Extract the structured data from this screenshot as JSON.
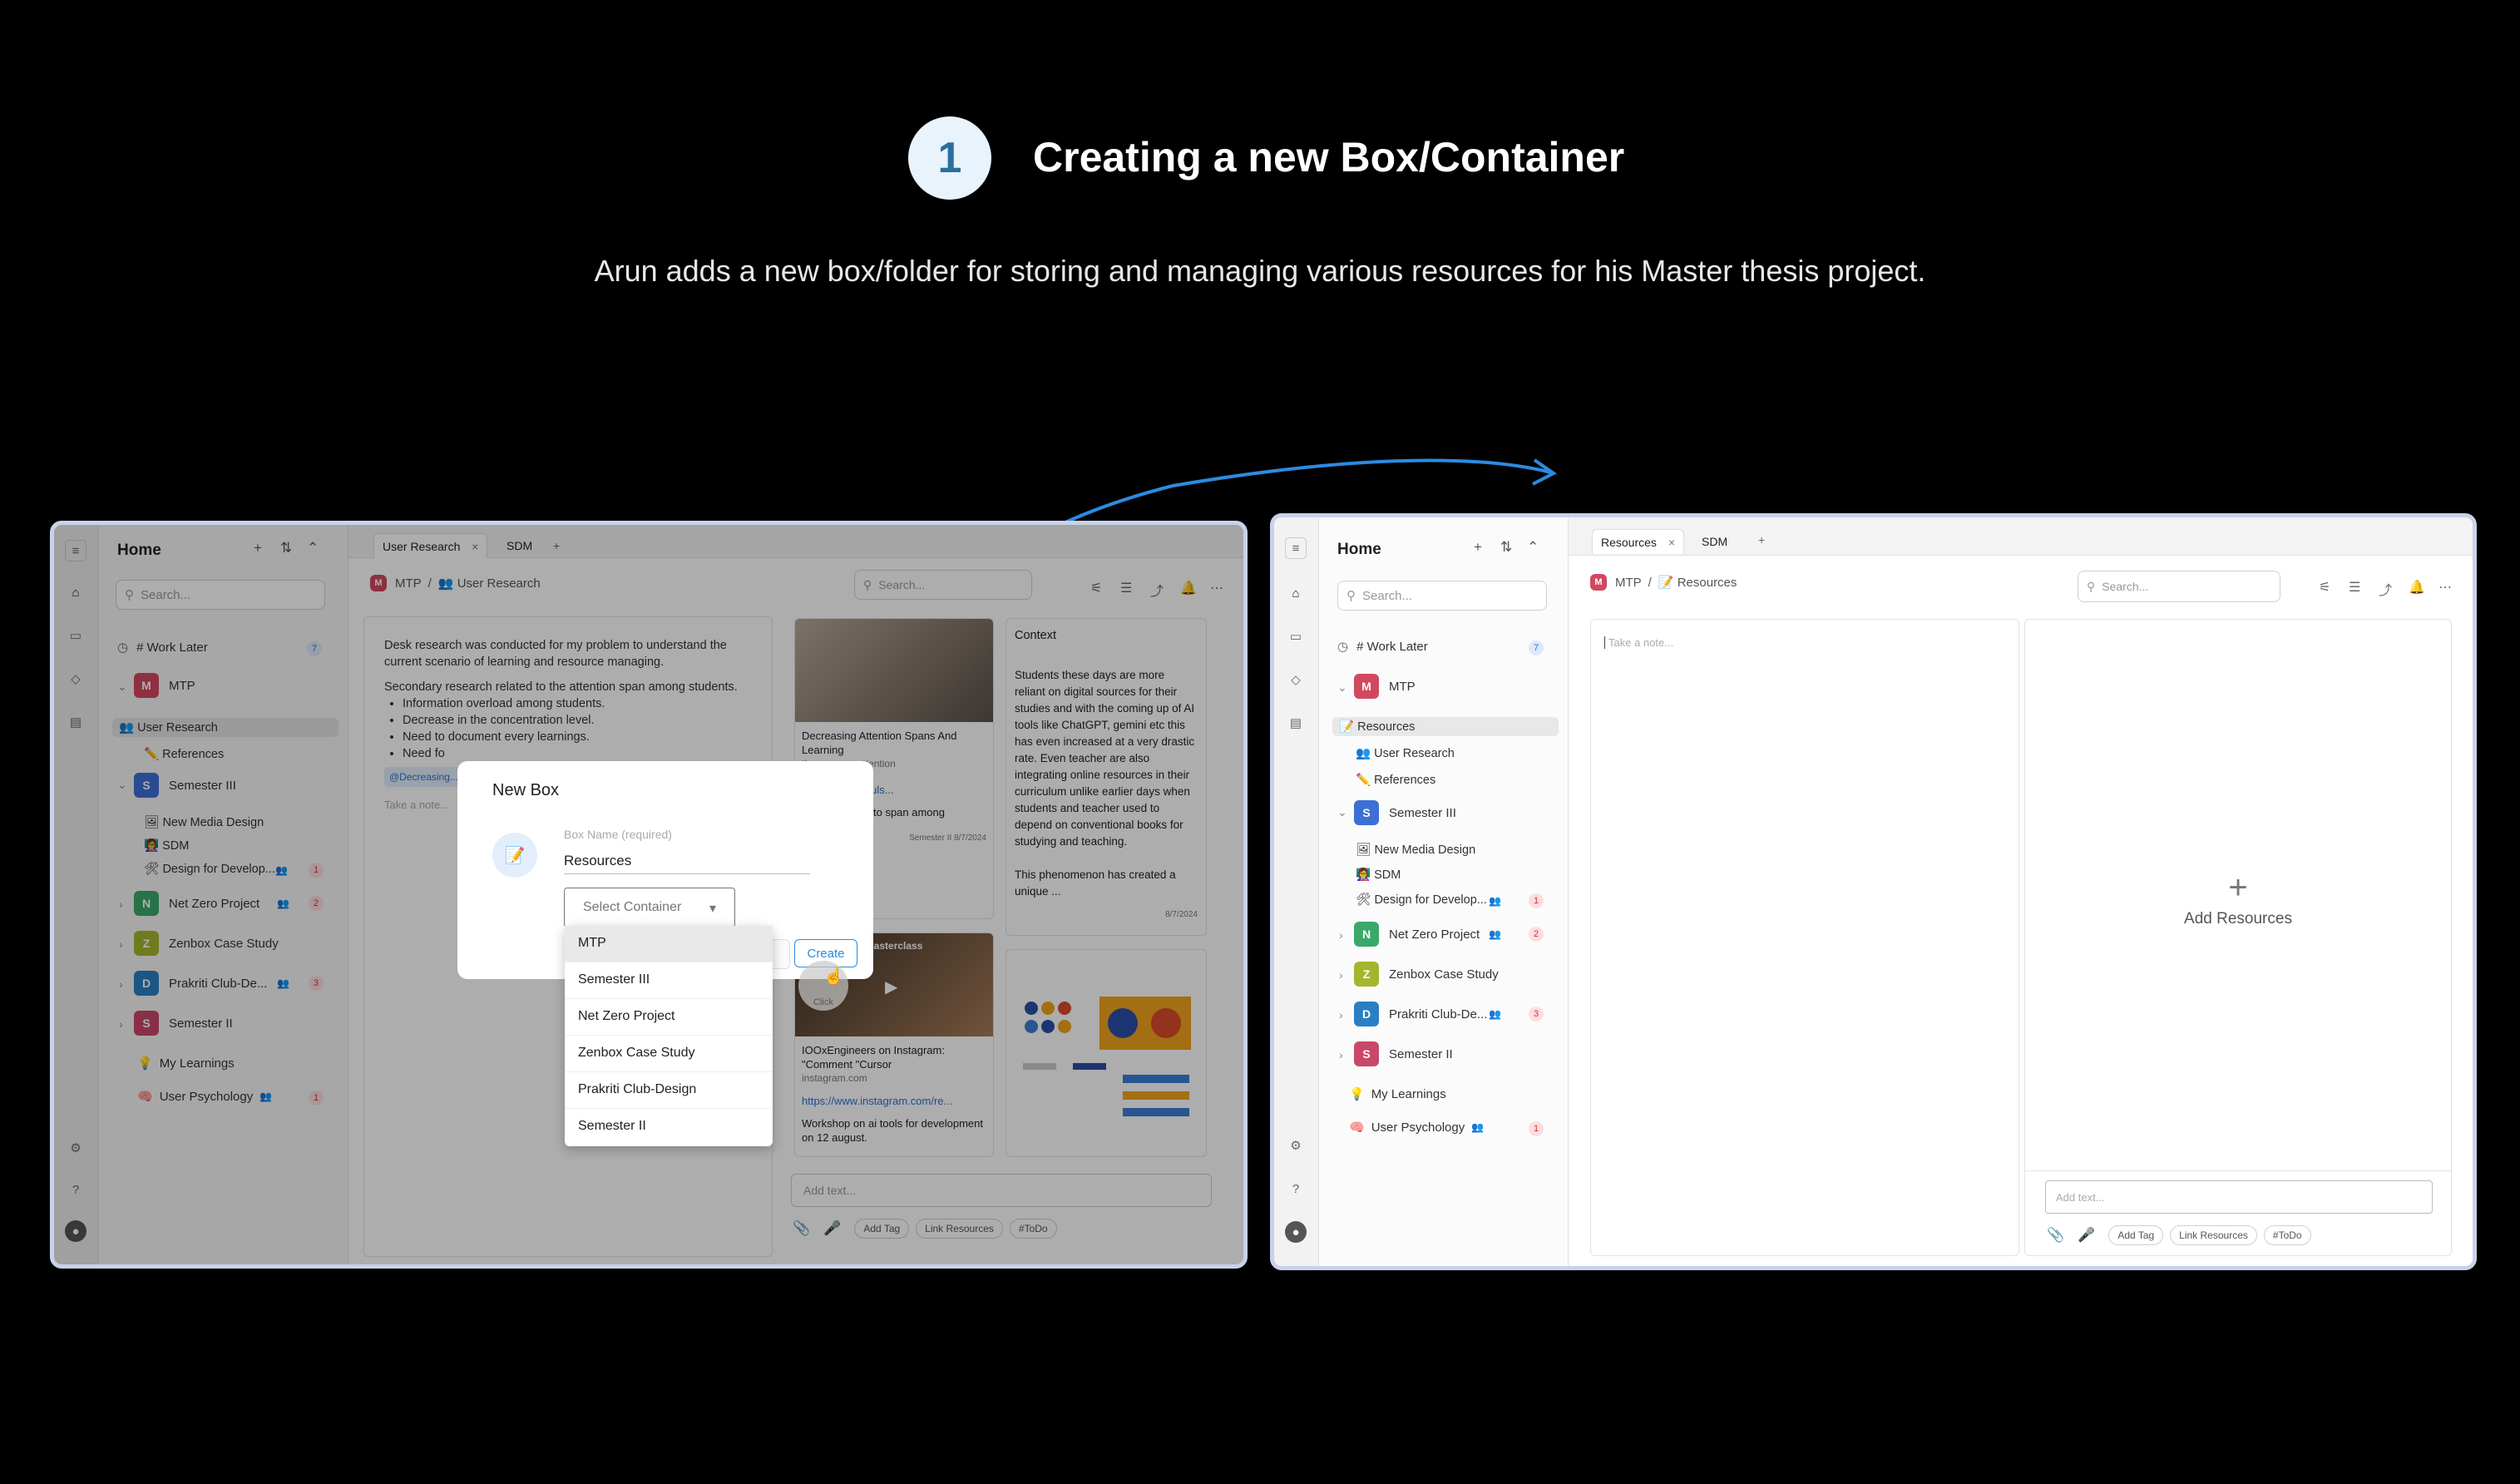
{
  "header": {
    "step_number": "1",
    "title": "Creating a new Box/Container",
    "description": "Arun adds a new box/folder for storing and managing various resources for his Master thesis project."
  },
  "colors": {
    "accent": "#2b8be0",
    "background": "#000000",
    "step_circle": "#e8f3fc"
  },
  "left_screen": {
    "sidebar": {
      "title": "Home",
      "search_placeholder": "Search...",
      "work_later": "# Work Later",
      "work_later_count": "7",
      "groups": [
        {
          "initial": "M",
          "color": "#d1485f",
          "name": "MTP",
          "children": [
            "User Research",
            "References"
          ],
          "child_icons": [
            "👥",
            "✏️"
          ]
        },
        {
          "initial": "S",
          "color": "#3d6fd6",
          "name": "Semester III",
          "children": [
            "New Media Design",
            "SDM",
            "Design for Develop..."
          ],
          "child_icons": [
            "🖼",
            "👩‍🏫",
            "🛠"
          ],
          "last_badge": "1"
        },
        {
          "initial": "N",
          "color": "#3aa86b",
          "name": "Net Zero Project",
          "badge": "2"
        },
        {
          "initial": "Z",
          "color": "#a5b52e",
          "name": "Zenbox Case Study"
        },
        {
          "initial": "D",
          "color": "#2a7fc4",
          "name": "Prakriti Club-De...",
          "badge": "3"
        },
        {
          "initial": "S",
          "color": "#c9486a",
          "name": "Semester II"
        }
      ],
      "my_learnings": "My Learnings",
      "user_psychology": "User Psychology",
      "user_psychology_badge": "1"
    },
    "tabs": [
      "User Research",
      "SDM"
    ],
    "breadcrumb": {
      "root": "MTP",
      "current": "User Research"
    },
    "search_placeholder": "Search...",
    "note": {
      "p1": "Desk research was conducted for my problem to understand the current scenario of learning and resource managing.",
      "p2": "Secondary research related to the attention span among students.",
      "bullets": [
        "Information overload among students.",
        "Decrease in the concentration level.",
        "Need to document every learnings.",
        "Need fo"
      ],
      "tag": "@Decreasing...",
      "placeholder": "Take a note..."
    },
    "cards": {
      "card1_title": "Decreasing Attention Spans And Learning",
      "card1_sub": "the average attention",
      "card1_link": "linkedin.com/puls...",
      "card1_text": "search related to span among",
      "card1_tag": "Semester II",
      "card1_date": "8/7/2024",
      "context_title": "Context",
      "context_text": "Students these days are more reliant on digital sources for their studies and with the coming up of AI tools like ChatGPT, gemini etc this has even increased at a very drastic rate. Even teacher are also integrating online resources in their curriculum unlike earlier days when students and teacher used to depend on conventional books for studying and teaching.",
      "context_text2": "This phenomenon has created a unique ...",
      "context_date": "8/7/2024",
      "card2_banner": "masterclass",
      "card2_title": "IOOxEngineers on Instagram: \"Comment \"Cursor",
      "card2_site": "instagram.com",
      "card2_link": "https://www.instagram.com/re...",
      "card2_text": "Workshop on ai tools for development on 12 august."
    },
    "composer": {
      "placeholder": "Add text...",
      "chips": [
        "Add Tag",
        "Link Resources",
        "#ToDo"
      ]
    },
    "dialog": {
      "title": "New Box",
      "name_label": "Box Name (required)",
      "name_value": "Resources",
      "select_label": "Select Container",
      "create": "Create",
      "click_hint": "Click"
    },
    "dropdown_options": [
      "MTP",
      "Semester III",
      "Net Zero Project",
      "Zenbox Case Study",
      "Prakriti Club-Design",
      "Semester II"
    ]
  },
  "right_screen": {
    "sidebar": {
      "title": "Home",
      "search_placeholder": "Search...",
      "work_later": "# Work Later",
      "work_later_count": "7",
      "mtp_children": [
        "Resources",
        "User Research",
        "References"
      ],
      "mtp_child_icons": [
        "📝",
        "👥",
        "✏️"
      ]
    },
    "tabs": [
      "Resources",
      "SDM"
    ],
    "breadcrumb": {
      "root": "MTP",
      "current": "Resources"
    },
    "search_placeholder": "Search...",
    "note_placeholder": "Take a note...",
    "add_resources": "Add Resources",
    "composer": {
      "placeholder": "Add text...",
      "chips": [
        "Add Tag",
        "Link Resources",
        "#ToDo"
      ]
    }
  }
}
